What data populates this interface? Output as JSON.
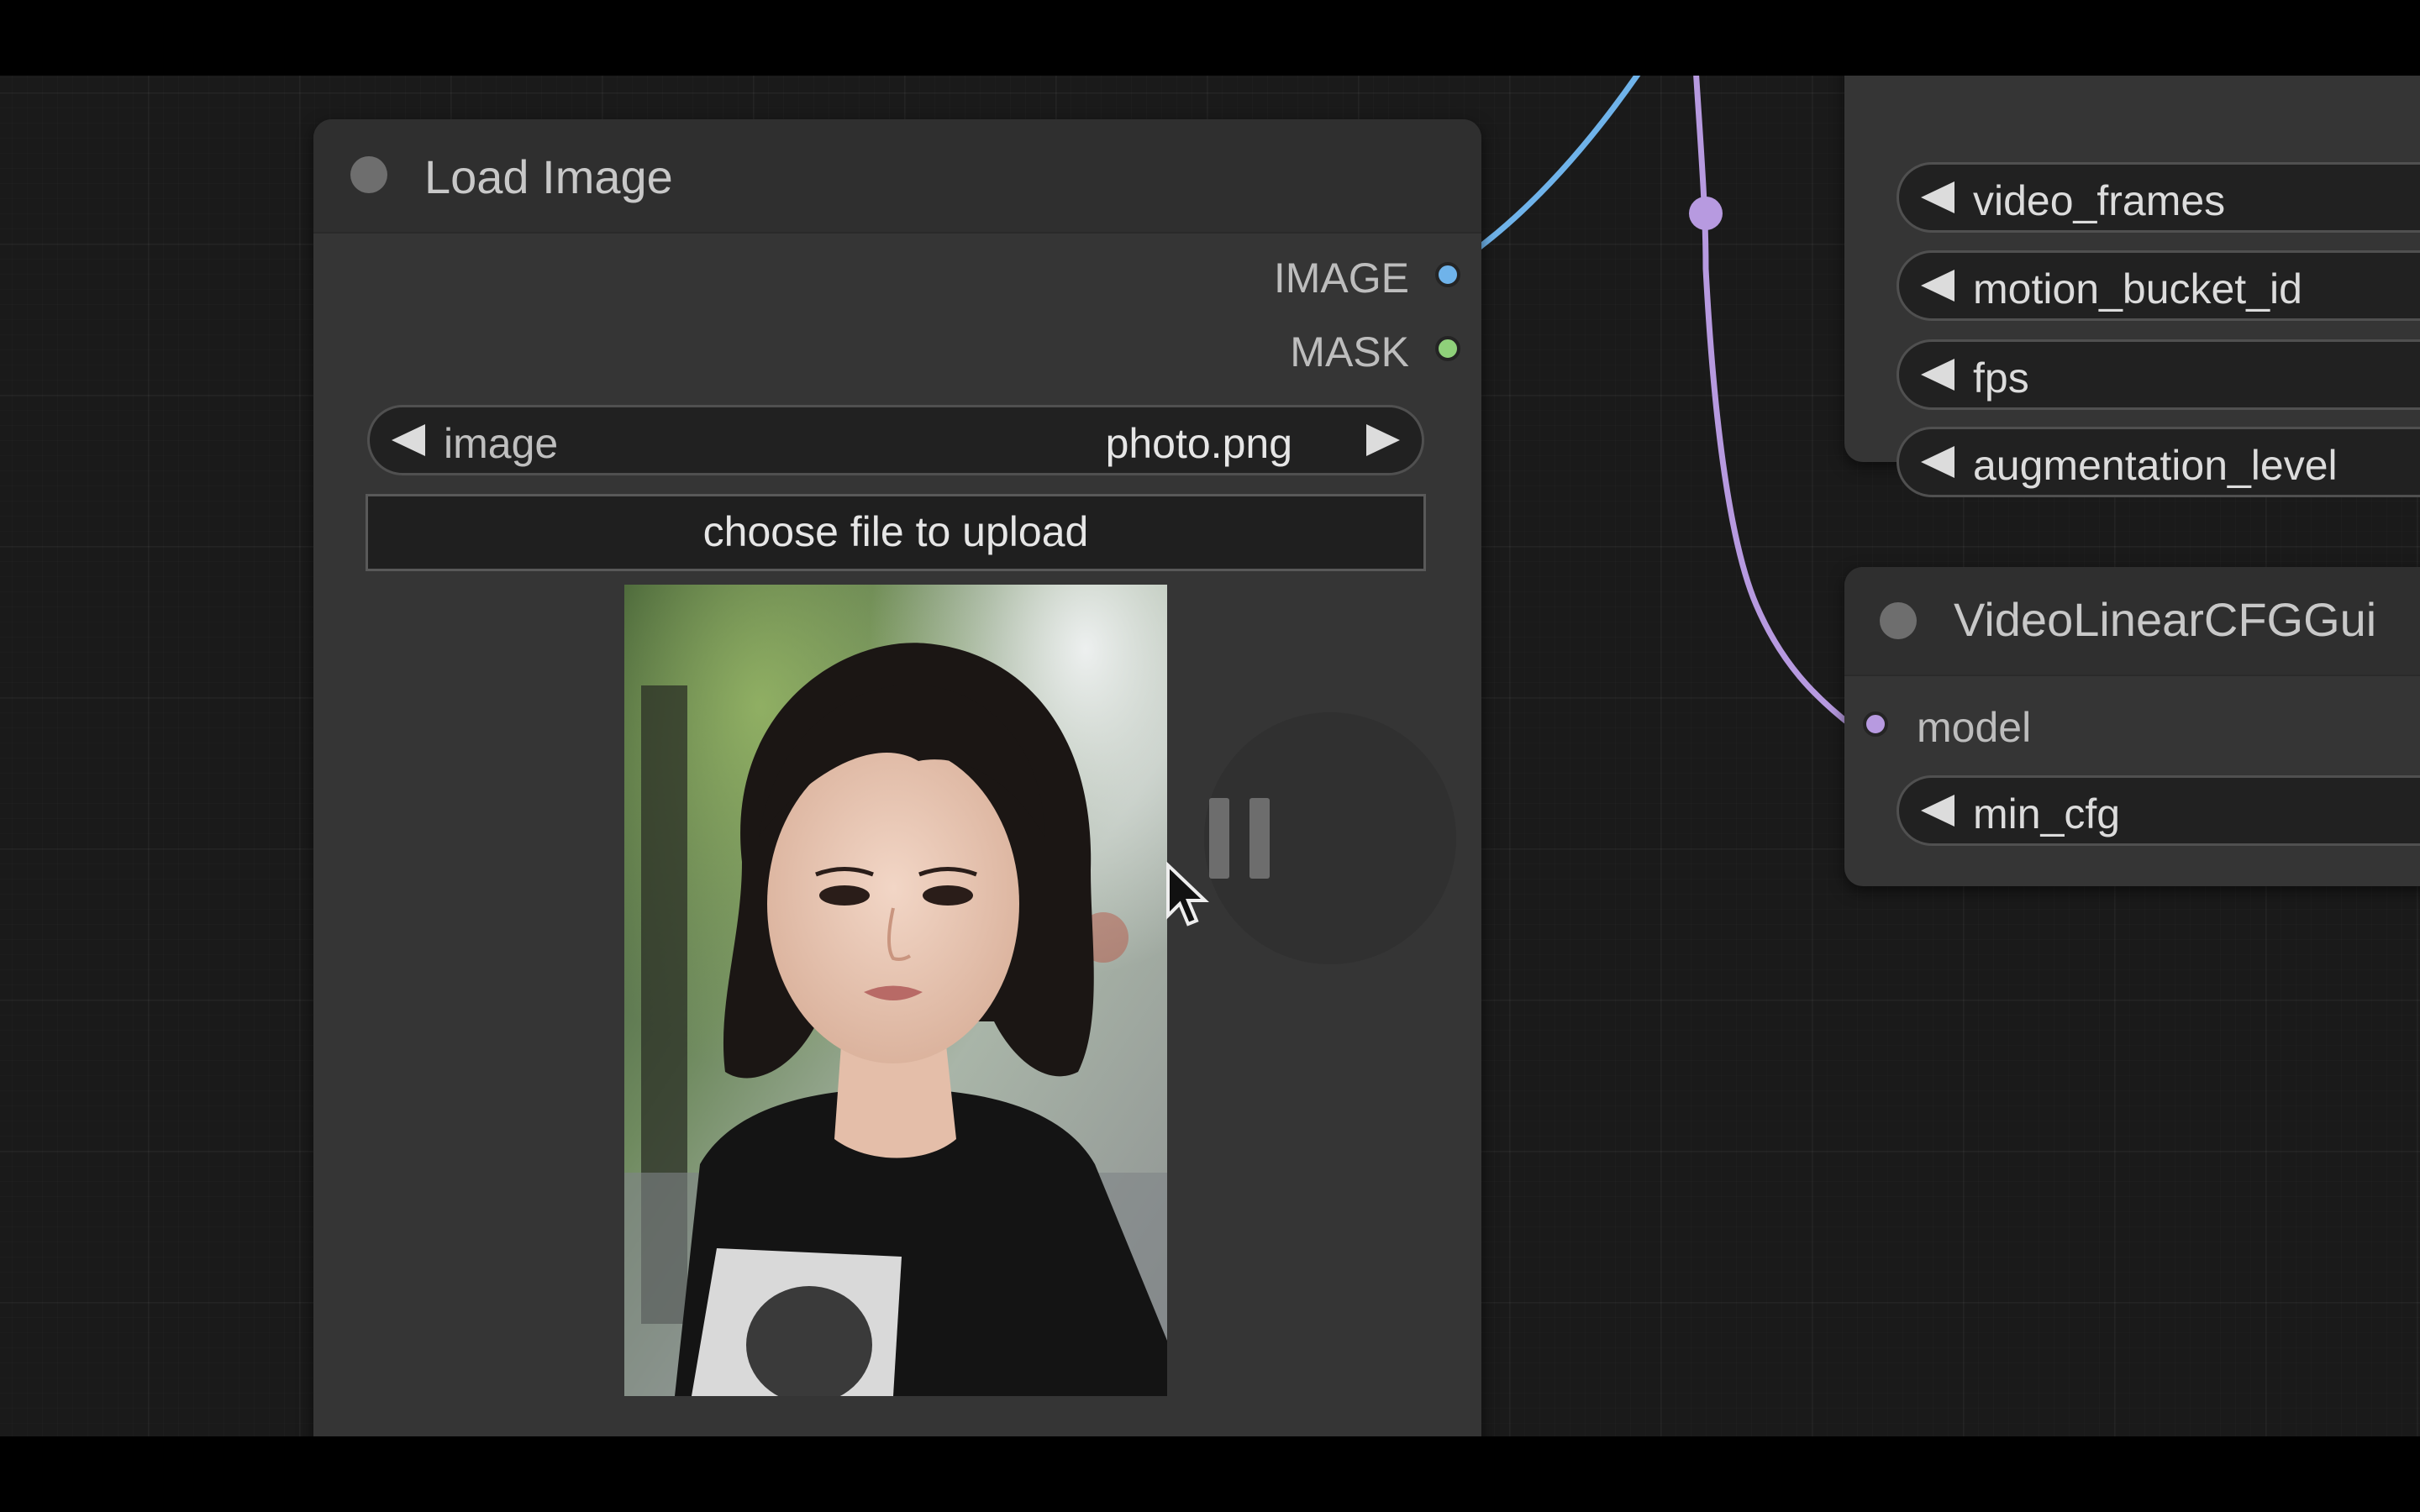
{
  "colors": {
    "image_link": "#6fb3ea",
    "mask_slot": "#8fd17a",
    "model_link": "#b79ae0",
    "node_bg": "#353535",
    "canvas_bg": "#1a1a1a"
  },
  "load_image_node": {
    "title": "Load Image",
    "outputs": [
      {
        "label": "IMAGE",
        "color": "#6fb3ea"
      },
      {
        "label": "MASK",
        "color": "#8fd17a"
      }
    ],
    "image_widget": {
      "label": "image",
      "value": "photo.png"
    },
    "upload_button": "choose file to upload",
    "preview_icon": "pause-icon"
  },
  "svd_node": {
    "inputs": [
      "video_frames",
      "motion_bucket_id",
      "fps",
      "augmentation_level"
    ]
  },
  "cfg_node": {
    "title": "VideoLinearCFGGui",
    "input_label": "model",
    "widget_label": "min_cfg"
  },
  "cursor": "mouse-pointer-icon"
}
